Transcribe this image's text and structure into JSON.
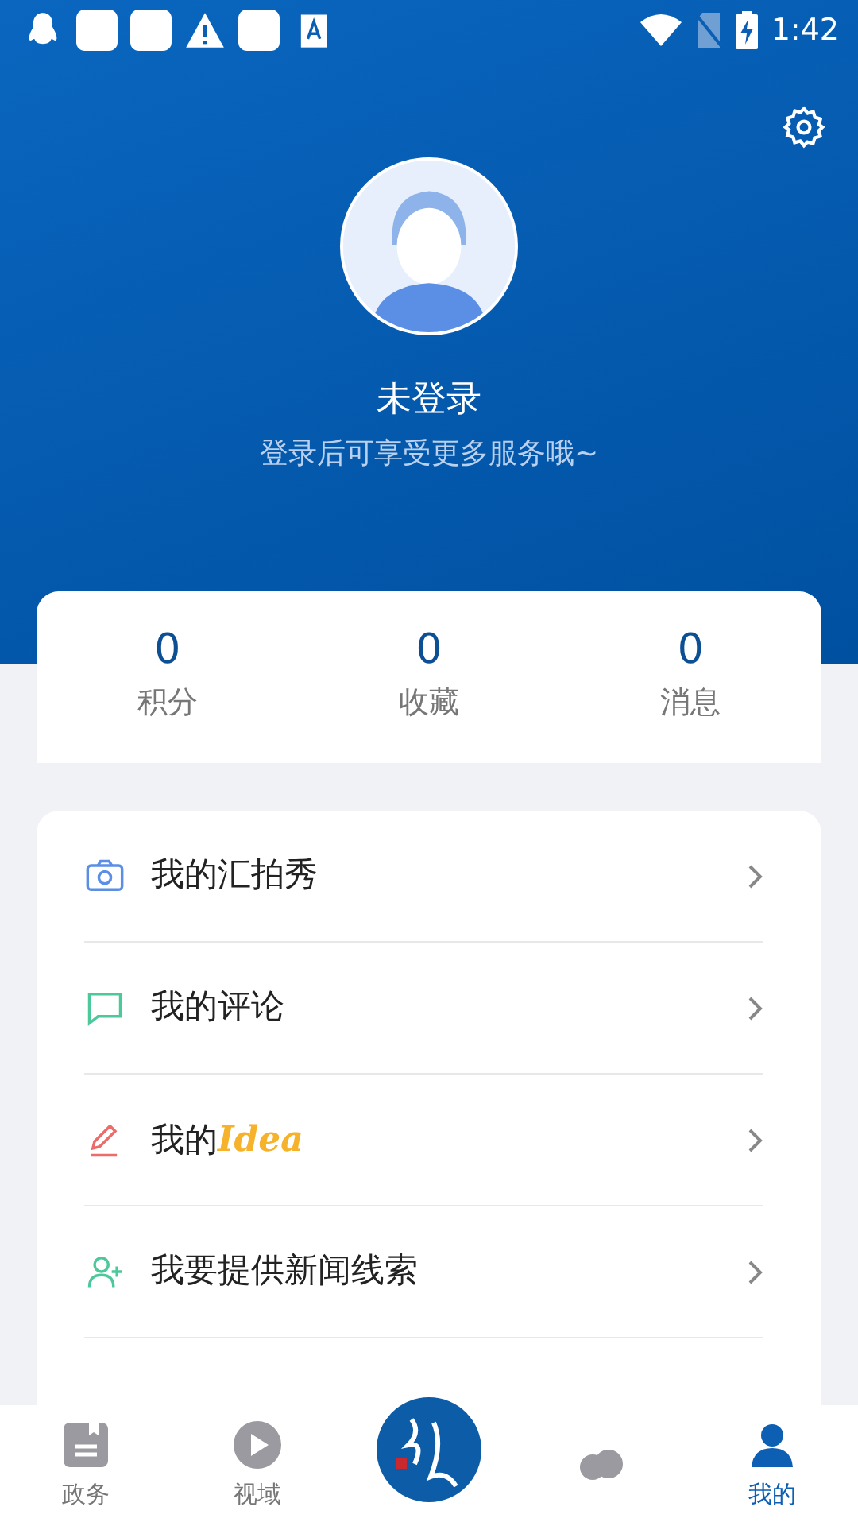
{
  "status_bar": {
    "time": "1:42"
  },
  "profile": {
    "name": "未登录",
    "subtitle": "登录后可享受更多服务哦~"
  },
  "stats": [
    {
      "value": "0",
      "label": "积分"
    },
    {
      "value": "0",
      "label": "收藏"
    },
    {
      "value": "0",
      "label": "消息"
    }
  ],
  "menu": [
    {
      "kind": "camera",
      "label": "我的汇拍秀"
    },
    {
      "kind": "comment",
      "label": "我的评论"
    },
    {
      "kind": "pencil",
      "label": "我的",
      "highlight": "Idea"
    },
    {
      "kind": "person-add",
      "label": "我要提供新闻线索"
    }
  ],
  "tab_bar": [
    {
      "kind": "book",
      "label": "政务",
      "selected": false
    },
    {
      "kind": "play",
      "label": "视域",
      "selected": false
    },
    {
      "kind": "logo",
      "selected": false
    },
    {
      "kind": "chat",
      "selected": false
    },
    {
      "kind": "person",
      "label": "我的",
      "selected": true
    }
  ]
}
